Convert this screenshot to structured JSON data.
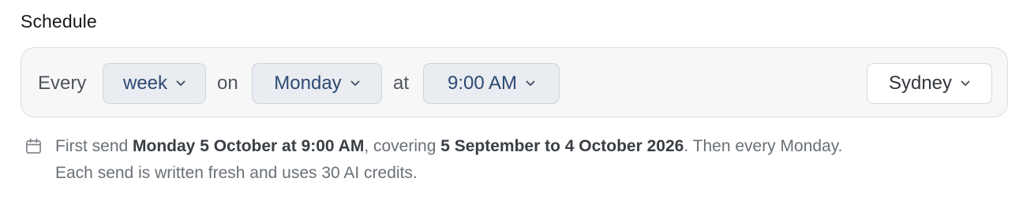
{
  "section": {
    "title": "Schedule"
  },
  "schedule": {
    "every_label": "Every",
    "frequency": "week",
    "on_label": "on",
    "day": "Monday",
    "at_label": "at",
    "time": "9:00 AM",
    "timezone": "Sydney"
  },
  "note": {
    "icon": "calendar-icon",
    "first_send_prefix": "First send ",
    "first_send_date": "Monday 5 October at 9:00 AM",
    "covering_prefix": ", covering ",
    "covering_range": "5 September to 4 October 2026",
    "then_text": ". Then every Monday.",
    "line2": "Each send is written fresh and uses 30 AI credits."
  },
  "colors": {
    "accent_text": "#2d4a73",
    "bar_background": "#f7f7f8",
    "pill_background": "#e9ecf0"
  }
}
